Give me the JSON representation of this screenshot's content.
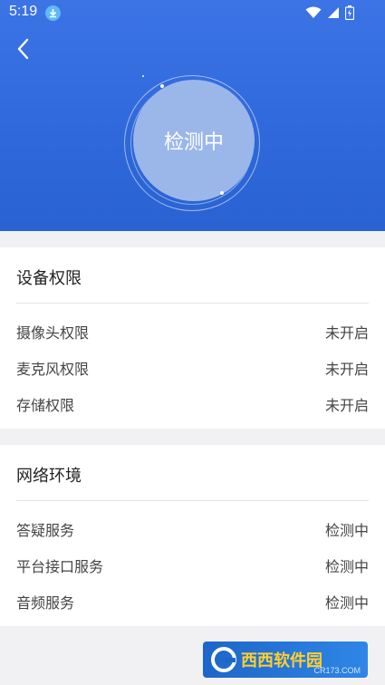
{
  "status_bar": {
    "time": "5:19"
  },
  "header": {
    "back_icon": "chevron-left-icon",
    "status_text": "检测中"
  },
  "device_permissions": {
    "title": "设备权限",
    "items": [
      {
        "label": "摄像头权限",
        "value": "未开启"
      },
      {
        "label": "麦克风权限",
        "value": "未开启"
      },
      {
        "label": "存储权限",
        "value": "未开启"
      }
    ]
  },
  "network": {
    "title": "网络环境",
    "items": [
      {
        "label": "答疑服务",
        "value": "检测中"
      },
      {
        "label": "平台接口服务",
        "value": "检测中"
      },
      {
        "label": "音频服务",
        "value": "检测中"
      }
    ]
  },
  "watermark": {
    "text": "西西软件园",
    "sub": "CR173.COM"
  },
  "colors": {
    "header": "#3c74e6",
    "circle": "#9bb7ea",
    "watermark_accent": "#ffcf2e"
  }
}
